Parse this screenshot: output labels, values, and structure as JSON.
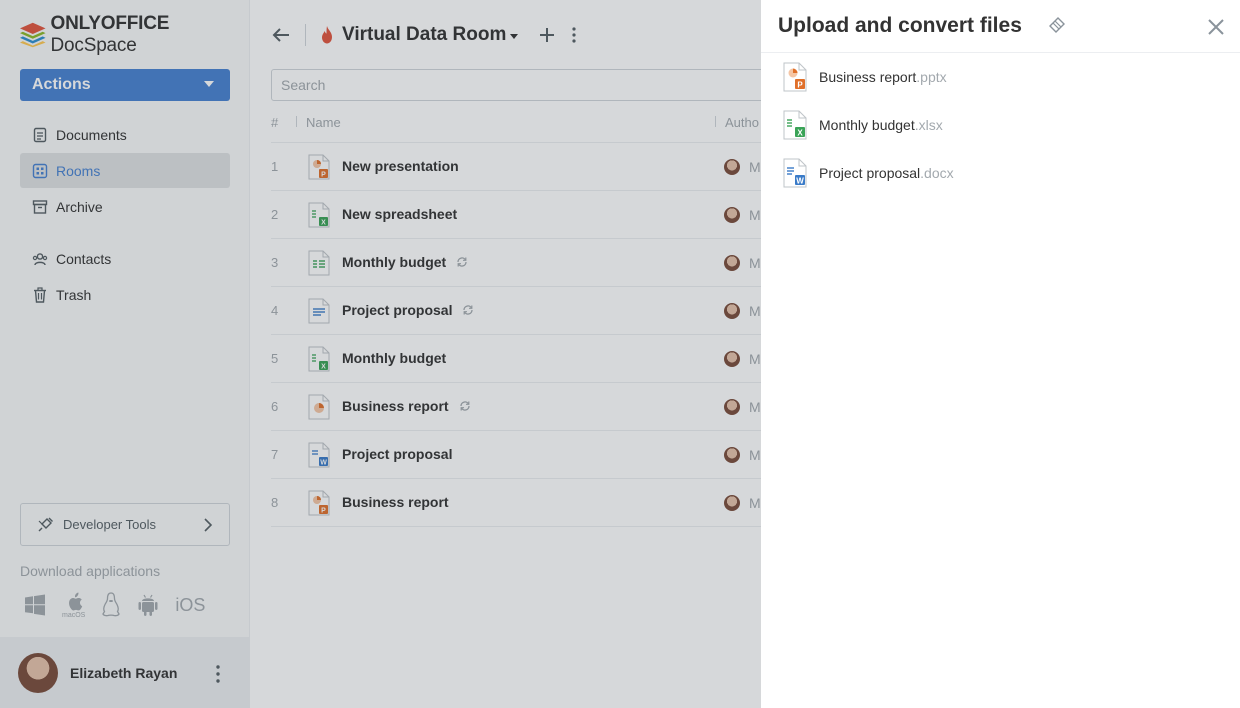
{
  "sidebar": {
    "logo": {
      "brand": "ONLYOFFICE",
      "product": " DocSpace"
    },
    "actions_label": "Actions",
    "nav": [
      {
        "label": "Documents",
        "icon": "documents-icon"
      },
      {
        "label": "Rooms",
        "icon": "rooms-icon",
        "active": true
      },
      {
        "label": "Archive",
        "icon": "archive-icon"
      },
      {
        "label": "Contacts",
        "icon": "contacts-icon"
      },
      {
        "label": "Trash",
        "icon": "trash-icon"
      }
    ],
    "developer_tools": "Developer Tools",
    "download_label": "Download applications",
    "apps": {
      "macos_label": "macOS",
      "ios_label": "iOS"
    },
    "profile_name": "Elizabeth Rayan"
  },
  "header": {
    "room_title": "Virtual Data Room"
  },
  "search": {
    "placeholder": "Search"
  },
  "table": {
    "columns": {
      "num": "#",
      "name": "Name",
      "author": "Autho"
    },
    "rows": [
      {
        "num": "1",
        "name": "New presentation",
        "type": "pptx",
        "synced": false,
        "author": "M"
      },
      {
        "num": "2",
        "name": "New spreadsheet",
        "type": "xlsx",
        "synced": false,
        "author": "M"
      },
      {
        "num": "3",
        "name": "Monthly budget",
        "type": "xlsx-template",
        "synced": true,
        "author": "M"
      },
      {
        "num": "4",
        "name": "Project proposal",
        "type": "docx-template",
        "synced": true,
        "author": "M"
      },
      {
        "num": "5",
        "name": "Monthly budget",
        "type": "xlsx",
        "synced": false,
        "author": "M"
      },
      {
        "num": "6",
        "name": "Business report",
        "type": "pptx-template",
        "synced": true,
        "author": "M"
      },
      {
        "num": "7",
        "name": "Project proposal",
        "type": "docx",
        "synced": false,
        "author": "M"
      },
      {
        "num": "8",
        "name": "Business report",
        "type": "pptx",
        "synced": false,
        "author": "M"
      }
    ]
  },
  "panel": {
    "title": "Upload and convert files",
    "files": [
      {
        "name": "Business report",
        "ext": ".pptx",
        "type": "pptx"
      },
      {
        "name": "Monthly budget",
        "ext": ".xlsx",
        "type": "xlsx"
      },
      {
        "name": "Project proposal",
        "ext": ".docx",
        "type": "docx"
      }
    ]
  },
  "colors": {
    "accent": "#4781d1",
    "pptx": "#e0702a",
    "xlsx": "#3aa357",
    "docx": "#3a7bc8",
    "fire": "#e2543d"
  }
}
